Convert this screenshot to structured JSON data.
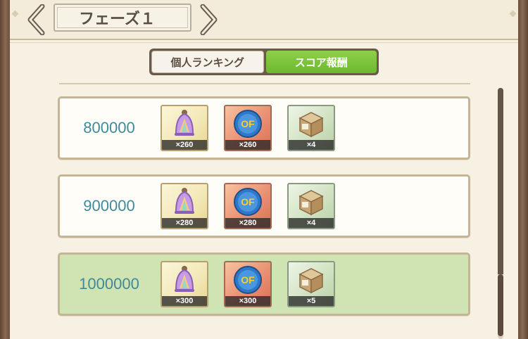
{
  "header": {
    "title": "フェーズ１",
    "prev_icon": "chevron-left-icon",
    "next_icon": "chevron-right-icon"
  },
  "tabs": [
    {
      "label": "個人ランキング",
      "active": false
    },
    {
      "label": "スコア報酬",
      "active": true
    }
  ],
  "rewards": [
    {
      "score": "800000",
      "items": [
        {
          "icon": "rainbow-bell-icon",
          "count": "×260"
        },
        {
          "icon": "of-coin-icon",
          "count": "×260"
        },
        {
          "icon": "supply-box-icon",
          "count": "×4"
        }
      ]
    },
    {
      "score": "900000",
      "items": [
        {
          "icon": "rainbow-bell-icon",
          "count": "×280"
        },
        {
          "icon": "of-coin-icon",
          "count": "×280"
        },
        {
          "icon": "supply-box-icon",
          "count": "×4"
        }
      ]
    },
    {
      "score": "1000000",
      "highlighted": true,
      "items": [
        {
          "icon": "rainbow-bell-icon",
          "count": "×300"
        },
        {
          "icon": "of-coin-icon",
          "count": "×300"
        },
        {
          "icon": "supply-box-icon",
          "count": "×5"
        }
      ]
    }
  ],
  "colors": {
    "score_text": "#3f8a98",
    "active_tab": "#7cc23a",
    "highlight_row": "#cfe3b3"
  }
}
